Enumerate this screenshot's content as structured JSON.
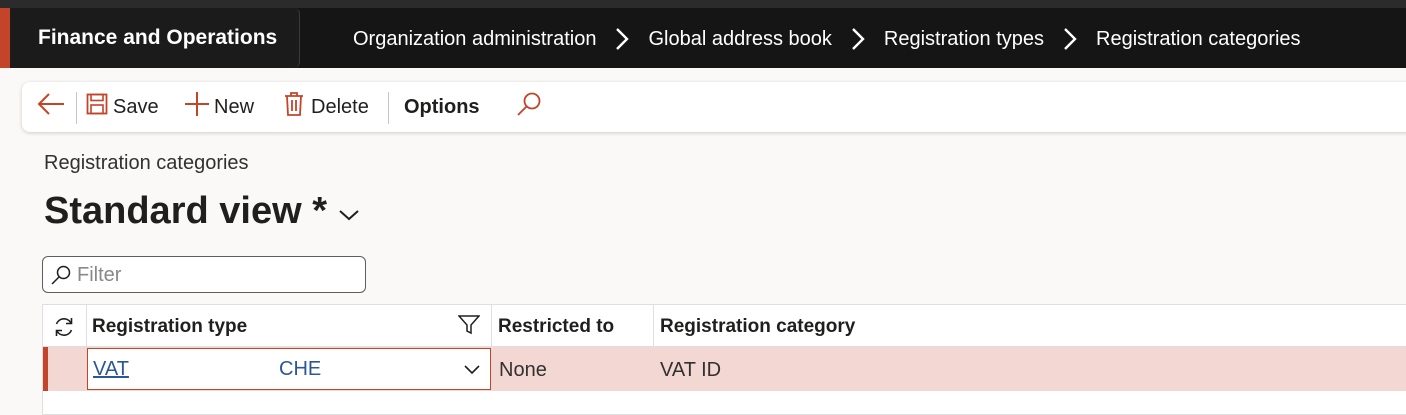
{
  "app": {
    "title": "Finance and Operations"
  },
  "breadcrumb": [
    "Organization administration",
    "Global address book",
    "Registration types",
    "Registration categories"
  ],
  "toolbar": {
    "back_icon": "arrow-left-icon",
    "save_label": "Save",
    "new_label": "New",
    "delete_label": "Delete",
    "options_label": "Options",
    "search_icon": "search-icon"
  },
  "page": {
    "caption": "Registration categories",
    "view_title": "Standard view *"
  },
  "filter": {
    "placeholder": "Filter"
  },
  "grid": {
    "columns": [
      "Registration type",
      "Restricted to",
      "Registration category"
    ],
    "rows": [
      {
        "registration_type": "VAT",
        "registration_type_sub": "CHE",
        "restricted_to": "None",
        "registration_category": "VAT ID"
      }
    ]
  },
  "colors": {
    "accent": "#c4442a",
    "topbar": "#151515",
    "selected_row": "#f2d7d3",
    "link": "#2b579a"
  }
}
